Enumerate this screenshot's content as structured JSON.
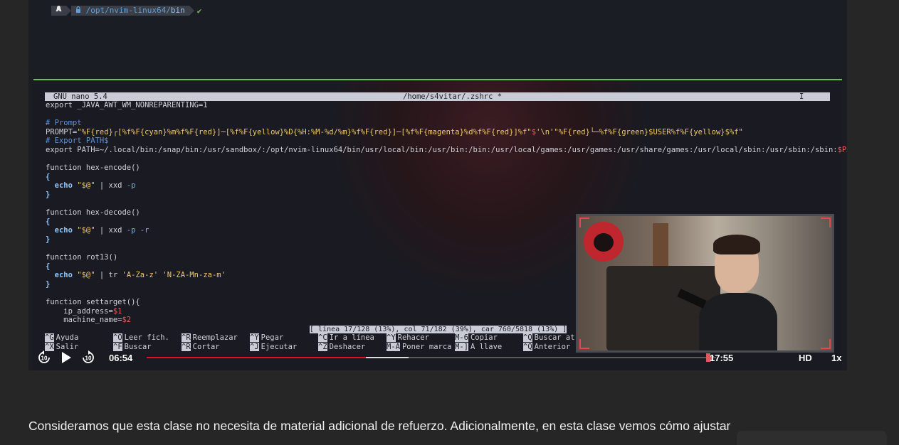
{
  "terminal": {
    "prompt": {
      "os_icon": "linux-tux-icon",
      "lock_icon": "lock-icon",
      "path_prefix": "/opt/nvim-linux64/",
      "path_dir": "bin",
      "status": "✔"
    }
  },
  "nano": {
    "version": "GNU nano 5.4",
    "file": "/home/s4vitar/.zshrc *",
    "cursor_glyph": "I",
    "status": "[ línea 17/128 (13%), col 71/182 (39%), car 760/5818 (13%) ]",
    "shortcuts": [
      [
        {
          "key": "^G",
          "label": "Ayuda"
        },
        {
          "key": "^O",
          "label": "Leer fich."
        },
        {
          "key": "^R",
          "label": "Reemplazar"
        },
        {
          "key": "^Y",
          "label": "Pegar"
        },
        {
          "key": "^C",
          "label": "Ir a línea"
        },
        {
          "key": "^Y",
          "label": "Rehacer"
        },
        {
          "key": "M-6",
          "label": "Copiar"
        },
        {
          "key": "^Q",
          "label": "Buscar atr"
        }
      ],
      [
        {
          "key": "^X",
          "label": "Salir"
        },
        {
          "key": "^F",
          "label": "Buscar"
        },
        {
          "key": "^R",
          "label": "Cortar"
        },
        {
          "key": "^J",
          "label": "Ejecutar"
        },
        {
          "key": "^Z",
          "label": "Deshacer"
        },
        {
          "key": "M-A",
          "label": "Poner marca"
        },
        {
          "key": "M-]",
          "label": "A llave"
        },
        {
          "key": "^Q",
          "label": "Anterior"
        }
      ]
    ]
  },
  "player": {
    "rewind_label": "10",
    "forward_label": "10",
    "current_time": "06:54",
    "total_time": "17:55",
    "quality": "HD",
    "speed": "1x",
    "progress_fraction": 0.385,
    "buffered_fraction": 0.46,
    "colors": {
      "progress": "#e0141e",
      "accent_green": "#6fbf4e"
    }
  },
  "page": {
    "description": "Consideramos que esta clase no necesita de material adicional de refuerzo. Adicionalmente, en esta clase vemos cómo ajustar"
  }
}
